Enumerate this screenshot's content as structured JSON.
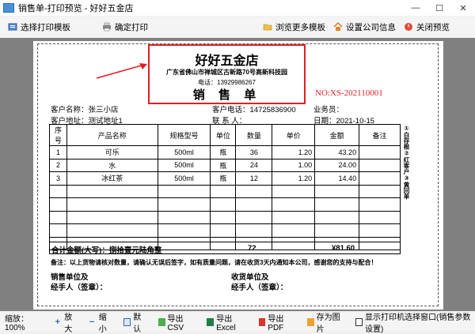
{
  "window": {
    "title": "销售单-打印预览 - 好好五金店",
    "minimize": "—",
    "maximize": "☐",
    "close": "✕"
  },
  "toolbar": {
    "select_template": "选择打印模板",
    "confirm_print": "确定打印",
    "browse_templates": "浏览更多模板",
    "company_info": "设置公司信息",
    "close_preview": "关闭预览"
  },
  "document": {
    "shop_name": "好好五金店",
    "address": "广东省佛山市禅城区古新路70号高新科技园",
    "phone": "电话：13929986267",
    "title": "销 售 单",
    "number": "NO:XS-202110001",
    "customer_name": "客户名称：张三小店",
    "customer_phone": "客户电话：14725836900",
    "salesperson": "业务员：",
    "customer_address": "客户地址：测试地址1",
    "contact": "联 系 人：",
    "date": "日期：2021-10-15",
    "columns": [
      "序号",
      "产品名称",
      "规格型号",
      "单位",
      "数量",
      "单价",
      "金额",
      "备注"
    ],
    "rows": [
      [
        "1",
        "可乐",
        "500ml",
        "瓶",
        "36",
        "1.20",
        "43.20",
        ""
      ],
      [
        "2",
        "水",
        "500ml",
        "瓶",
        "24",
        "1.00",
        "24.00",
        ""
      ],
      [
        "3",
        "冰红茶",
        "500ml",
        "瓶",
        "12",
        "1.20",
        "14.40",
        ""
      ]
    ],
    "total_label": "合计金额(大写)：捌拾壹元陆角整",
    "total_qty": "72",
    "total_amount": "¥81.60",
    "note": "备注：以上货物请核对数量，请确认无误后签字，如有质量问题，请在收货3天内通知本公司，感谢您的支持与配合！",
    "seller_unit": "销售单位及",
    "seller_sign": "经手人（签章）：",
    "buyer_unit": "收货单位及",
    "buyer_sign": "经手人（签章）：",
    "side_text": "①白存根②红客户③黄回单"
  },
  "statusbar": {
    "zoom": "缩放：100%",
    "zoom_in": "放大",
    "zoom_out": "缩小",
    "default": "默认",
    "export_csv": "导出CSV",
    "export_excel": "导出Excel",
    "export_pdf": "导出PDF",
    "save_image": "存为图片",
    "show_printer": "显示打印机选择窗口(销售参数设置)"
  },
  "colors": {
    "accent_red": "#e31e24",
    "gray_bg": "#808080"
  }
}
